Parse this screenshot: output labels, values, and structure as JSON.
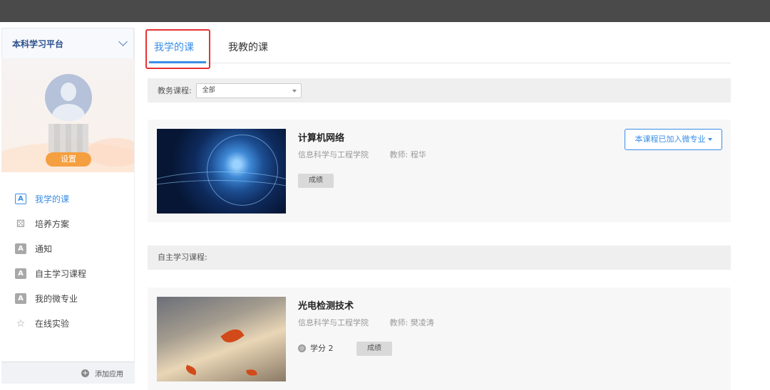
{
  "sidebar": {
    "platform_name": "本科学习平台",
    "settings_label": "设置",
    "nav": [
      {
        "label": "我学的课",
        "icon": "course-icon",
        "active": true
      },
      {
        "label": "培养方案",
        "icon": "binoculars-icon"
      },
      {
        "label": "通知",
        "icon": "notice-icon"
      },
      {
        "label": "自主学习课程",
        "icon": "self-study-icon"
      },
      {
        "label": "我的微专业",
        "icon": "micro-major-icon"
      },
      {
        "label": "在线实验",
        "icon": "star-icon"
      }
    ],
    "add_app_label": "添加应用"
  },
  "tabs": {
    "learn": "我学的课",
    "teach": "我教的课"
  },
  "filter": {
    "label": "教务课程:",
    "selected": "全部"
  },
  "courses": [
    {
      "title": "计算机网络",
      "college": "信息科学与工程学院",
      "teacher": "教师: 程华",
      "grade_label": "成绩",
      "join_label": "本课程已加入微专业",
      "image": "globe-network-image"
    }
  ],
  "self_study": {
    "section_label": "自主学习课程:",
    "courses": [
      {
        "title": "光电检测技术",
        "college": "信息科学与工程学院",
        "teacher": "教师: 樊凌涛",
        "credit": "学分 2",
        "grade_label": "成绩",
        "image": "autumn-leaf-image"
      }
    ]
  },
  "colors": {
    "accent": "#3a8ee6",
    "highlight": "#e63232",
    "settings": "#f5a040",
    "topbar": "#4a4a4a"
  }
}
